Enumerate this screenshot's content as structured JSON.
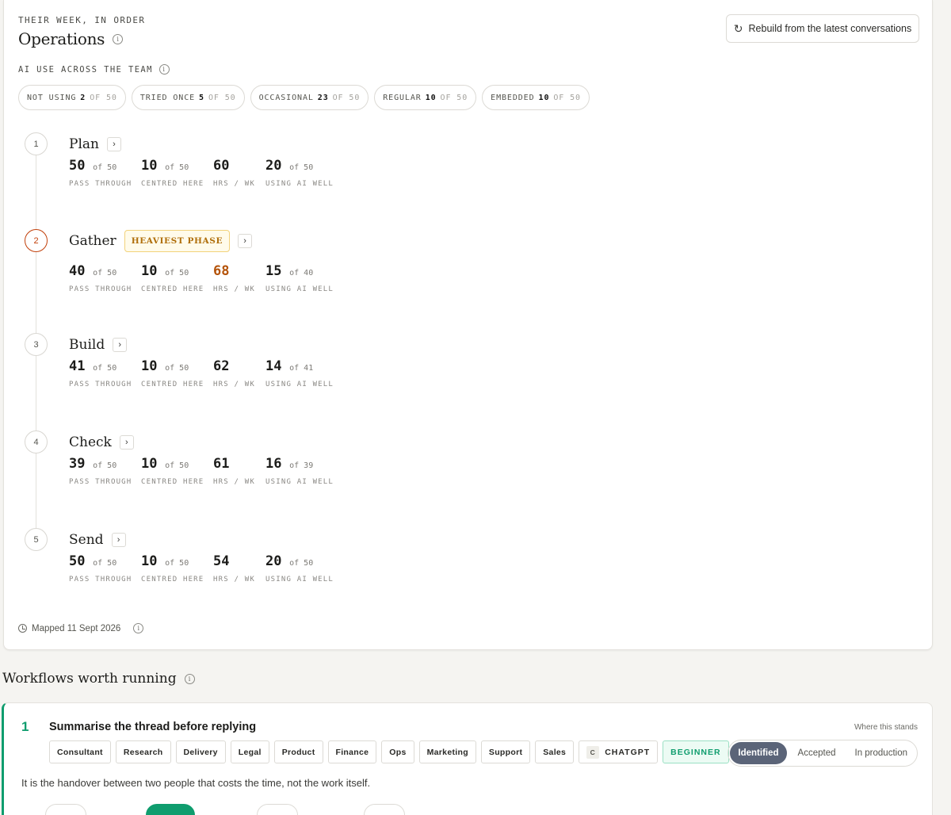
{
  "header": {
    "eyebrow": "THEIR WEEK, IN ORDER",
    "title": "Operations",
    "rebuild_label": "Rebuild from the latest conversations"
  },
  "ai_use": {
    "label": "AI USE ACROSS THE TEAM",
    "pills": [
      {
        "label": "NOT USING",
        "count": "2",
        "of": "OF 50"
      },
      {
        "label": "TRIED ONCE",
        "count": "5",
        "of": "OF 50"
      },
      {
        "label": "OCCASIONAL",
        "count": "23",
        "of": "OF 50"
      },
      {
        "label": "REGULAR",
        "count": "10",
        "of": "OF 50"
      },
      {
        "label": "EMBEDDED",
        "count": "10",
        "of": "OF 50"
      }
    ]
  },
  "stat_labels": {
    "pass": "PASS THROUGH",
    "centred": "CENTRED HERE",
    "hrs": "HRS / WK",
    "ai": "USING AI WELL"
  },
  "phases": [
    {
      "step": "1",
      "name": "Plan",
      "pass": "50",
      "pass_of": "of 50",
      "centred": "10",
      "centred_of": "of 50",
      "hrs": "60",
      "ai": "20",
      "ai_of": "of 50"
    },
    {
      "step": "2",
      "name": "Gather",
      "badge": "HEAVIEST PHASE",
      "pass": "40",
      "pass_of": "of 50",
      "centred": "10",
      "centred_of": "of 50",
      "hrs": "68",
      "ai": "15",
      "ai_of": "of 40"
    },
    {
      "step": "3",
      "name": "Build",
      "pass": "41",
      "pass_of": "of 50",
      "centred": "10",
      "centred_of": "of 50",
      "hrs": "62",
      "ai": "14",
      "ai_of": "of 41"
    },
    {
      "step": "4",
      "name": "Check",
      "pass": "39",
      "pass_of": "of 50",
      "centred": "10",
      "centred_of": "of 50",
      "hrs": "61",
      "ai": "16",
      "ai_of": "of 39"
    },
    {
      "step": "5",
      "name": "Send",
      "pass": "50",
      "pass_of": "of 50",
      "centred": "10",
      "centred_of": "of 50",
      "hrs": "54",
      "ai": "20",
      "ai_of": "of 50"
    }
  ],
  "mapped": "Mapped 11 Sept 2026",
  "workflows": {
    "title": "Workflows worth running",
    "items": [
      {
        "num": "1",
        "title": "Summarise the thread before replying",
        "where_label": "Where this stands",
        "tags": [
          "Consultant",
          "Research",
          "Delivery",
          "Legal",
          "Product",
          "Finance",
          "Ops",
          "Marketing",
          "Support",
          "Sales"
        ],
        "tool_letter": "C",
        "tool": "CHATGPT",
        "level": "BEGINNER",
        "stages": [
          "Identified",
          "Accepted",
          "In production"
        ],
        "description": "It is the handover between two people that costs the time, not the work itself."
      }
    ]
  },
  "colors": {
    "accent_green": "#0f9d6e",
    "heavy_orange": "#c2410c",
    "stage_active": "#5b6478"
  }
}
